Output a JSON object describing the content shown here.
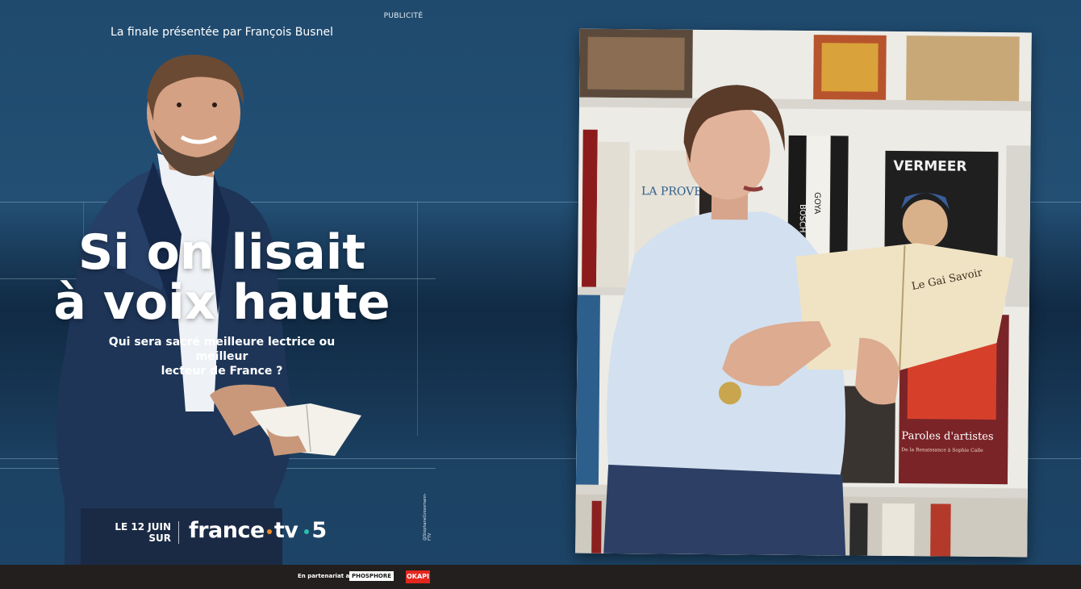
{
  "ad": {
    "label": "PUBLICITÉ",
    "presenter_line": "La finale présentée par François Busnel",
    "title_line1": "Si on lisait",
    "title_line2": "à voix haute",
    "subtitle_line1": "Qui sera sacré meilleure lectrice ou meilleur",
    "subtitle_line2": "lecteur de France ?",
    "date_line1": "LE 12 JUIN",
    "date_line2": "SUR",
    "brand_france": "france",
    "brand_tv": "tv",
    "brand_channel": "5",
    "photo_credit": "@StéphaneGrossmann-FTV",
    "partner_text": "En partenariat avec",
    "partner1": "PHOSPHORE",
    "partner2": "OKAPI",
    "photo": {
      "book_spine_vermeer": "VERMEER",
      "book_spine_provence": "LA PROVENCE",
      "book_spine_bosch": "BOSCH",
      "book_spine_goya": "GOYA",
      "book_spine_paroles": "Paroles d'artistes",
      "book_spine_paroles_sub": "De la Renaissance à Sophie Calle",
      "book_title": "Le Gai Savoir"
    }
  },
  "colors": {
    "background": "#1f4a6e",
    "dot_orange": "#f28c28",
    "dot_teal": "#2bbfb0"
  }
}
